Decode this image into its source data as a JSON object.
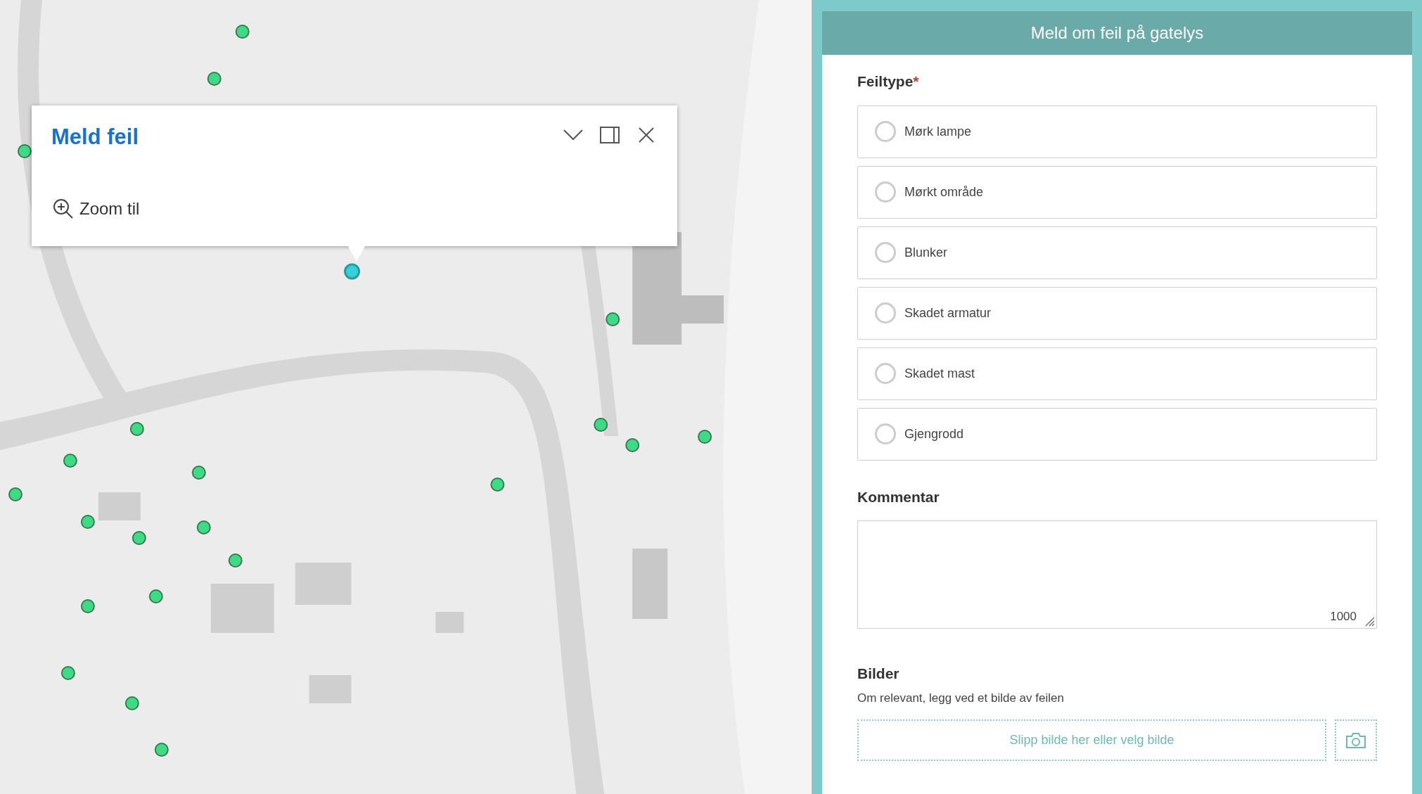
{
  "popup": {
    "title": "Meld feil",
    "actions": [
      {
        "kind": "collapse"
      },
      {
        "kind": "dock"
      },
      {
        "kind": "close"
      }
    ],
    "zoom_label": "Zoom til"
  },
  "form": {
    "title": "Meld om feil på gatelys",
    "type_field": {
      "label": "Feiltype",
      "required_mark": "*",
      "options": [
        {
          "label": "Mørk lampe",
          "selected": false
        },
        {
          "label": "Mørkt område",
          "selected": false
        },
        {
          "label": "Blunker",
          "selected": false
        },
        {
          "label": "Skadet armatur",
          "selected": false
        },
        {
          "label": "Skadet mast",
          "selected": false
        },
        {
          "label": "Gjengrodd",
          "selected": false
        }
      ]
    },
    "comment": {
      "label": "Kommentar",
      "counter": "1000"
    },
    "images": {
      "label": "Bilder",
      "hint": "Om relevant, legg ved et bilde av feilen",
      "dropzone": "Slipp bilde her eller velg bilde"
    }
  }
}
